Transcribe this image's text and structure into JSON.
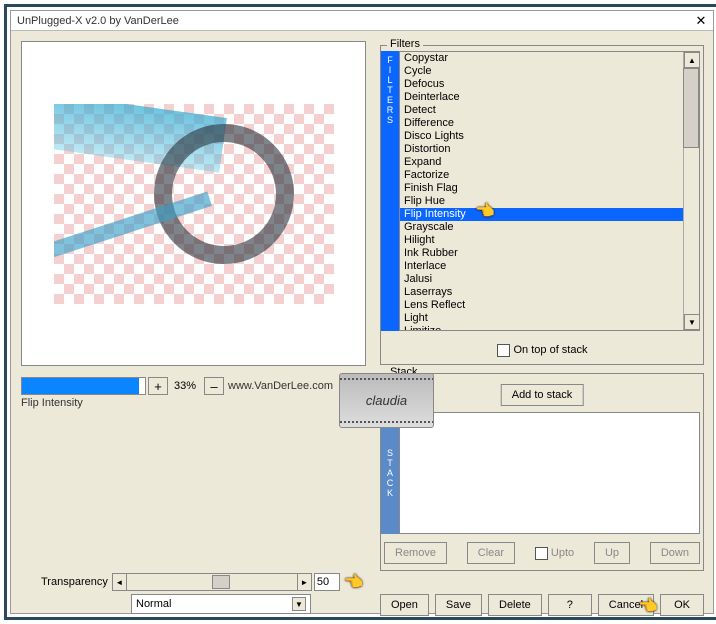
{
  "window": {
    "title": "UnPlugged-X v2.0 by VanDerLee"
  },
  "zoom": {
    "percent": "33%",
    "plus": "+",
    "minus": "–"
  },
  "url": "www.VanDerLee.com",
  "current_filter": "Flip Intensity",
  "filters": {
    "legend": "Filters",
    "side_label": "FILTERS",
    "items": [
      "Copystar",
      "Cycle",
      "Defocus",
      "Deinterlace",
      "Detect",
      "Difference",
      "Disco Lights",
      "Distortion",
      "Expand",
      "Factorize",
      "Finish Flag",
      "Flip Hue",
      "Flip Intensity",
      "Grayscale",
      "Hilight",
      "Ink Rubber",
      "Interlace",
      "Jalusi",
      "Laserrays",
      "Lens Reflect",
      "Light",
      "Limitize"
    ],
    "selected_index": 12,
    "on_top_label": "On top of stack"
  },
  "stack": {
    "legend": "Stack",
    "side_label": "STACK",
    "add_label": "Add to stack",
    "btns": {
      "remove": "Remove",
      "clear": "Clear",
      "upto": "Upto",
      "up": "Up",
      "down": "Down"
    }
  },
  "transparency": {
    "label": "Transparency",
    "value": "50"
  },
  "blend": {
    "selected": "Normal"
  },
  "bottom": {
    "open": "Open",
    "save": "Save",
    "delete": "Delete",
    "help": "?",
    "cancel": "Cancel",
    "ok": "OK"
  },
  "watermark": "claudia"
}
